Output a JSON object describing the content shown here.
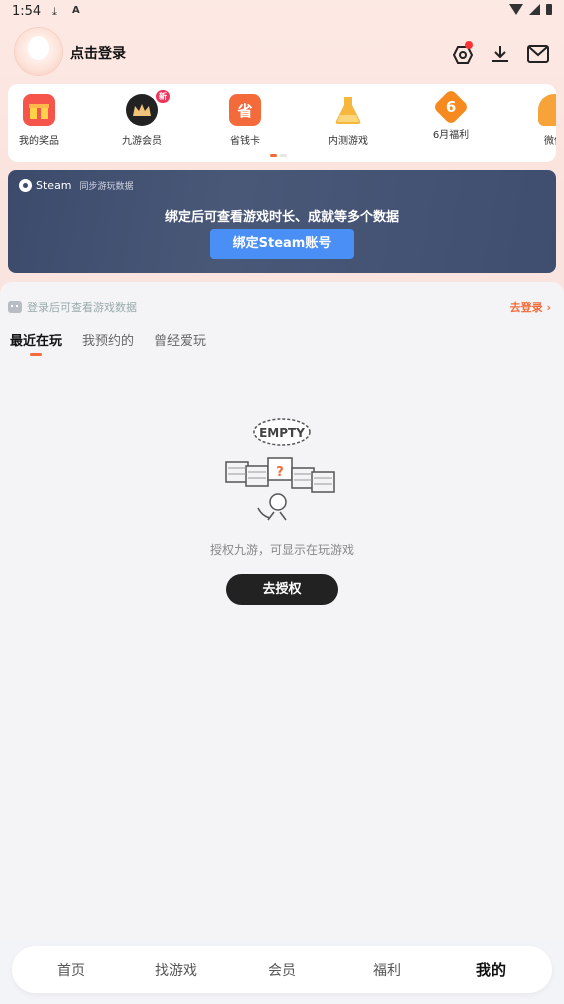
{
  "status_bar": {
    "time": "1:54"
  },
  "header": {
    "login_label": "点击登录"
  },
  "quick_items": [
    {
      "label": "我的奖品",
      "icon": "gift-icon",
      "color": "#f5554a"
    },
    {
      "label": "九游会员",
      "icon": "crown-icon",
      "color": "#222222",
      "badge": "新"
    },
    {
      "label": "省钱卡",
      "icon": "savings-card-icon",
      "glyph": "省",
      "color": "#f36b3a"
    },
    {
      "label": "内测游戏",
      "icon": "flask-icon",
      "color": "#f6b73c"
    },
    {
      "label": "6月福利",
      "icon": "six-badge-icon",
      "glyph": "6",
      "color": "#f68a1f"
    },
    {
      "label": "微信",
      "icon": "bell-icon",
      "color": "#f6a33a"
    }
  ],
  "steam": {
    "brand": "Steam",
    "subtitle": "同步游玩数据",
    "description": "绑定后可查看游戏时长、成就等多个数据",
    "button_label": "绑定Steam账号"
  },
  "game_section": {
    "notice": "登录后可查看游戏数据",
    "go_login": "去登录 ›",
    "tabs": [
      "最近在玩",
      "我预约的",
      "曾经爱玩"
    ],
    "active_tab": 0,
    "empty_badge": "EMPTY",
    "empty_text": "授权九游，可显示在玩游戏",
    "auth_button": "去授权"
  },
  "bottom_nav": {
    "items": [
      "首页",
      "找游戏",
      "会员",
      "福利",
      "我的"
    ],
    "active": 4
  },
  "colors": {
    "accent": "#f36b3a",
    "steam_button": "#4a8ff5",
    "dark_button": "#222222"
  }
}
